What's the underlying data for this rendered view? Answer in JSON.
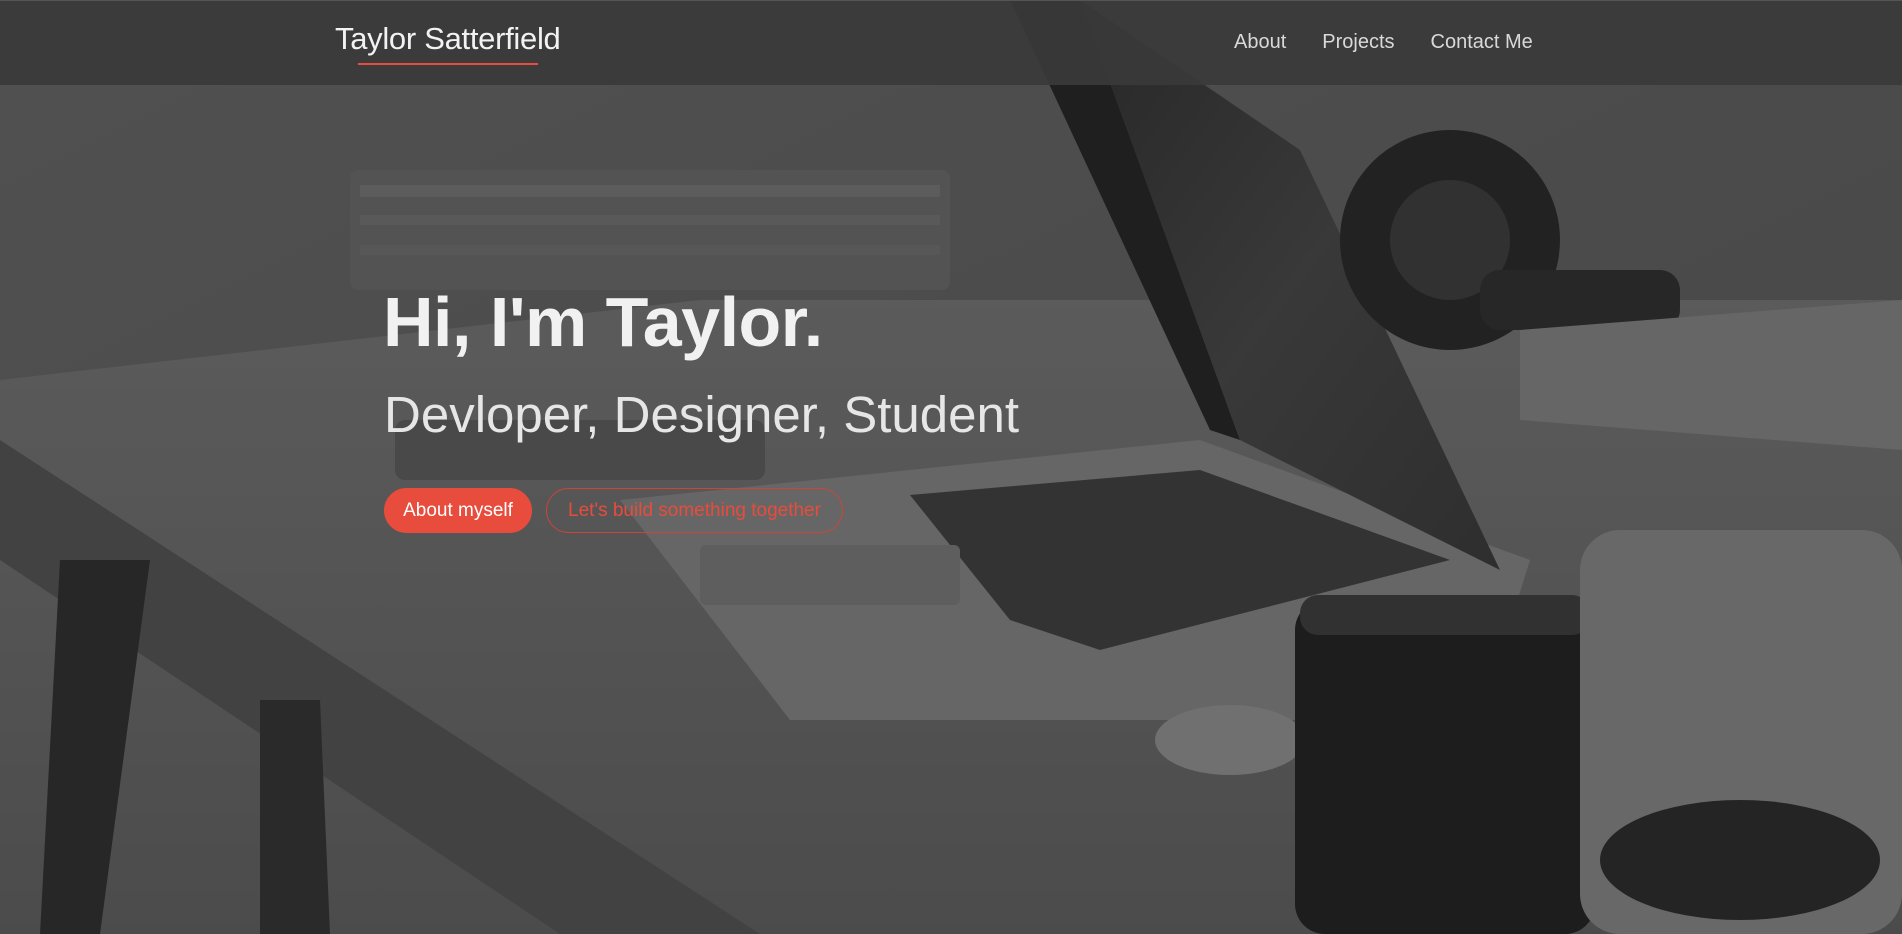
{
  "navbar": {
    "brand": "Taylor Satterfield",
    "links": [
      {
        "label": "About"
      },
      {
        "label": "Projects"
      },
      {
        "label": "Contact Me"
      }
    ]
  },
  "hero": {
    "title": "Hi, I'm Taylor.",
    "subtitle": "Devloper, Designer, Student",
    "primary_button": "About myself",
    "secondary_button": "Let's build something together"
  },
  "colors": {
    "accent": "#e74c3c",
    "navbar_bg": "#3a3a3a",
    "text_light": "#f1f1f1"
  }
}
